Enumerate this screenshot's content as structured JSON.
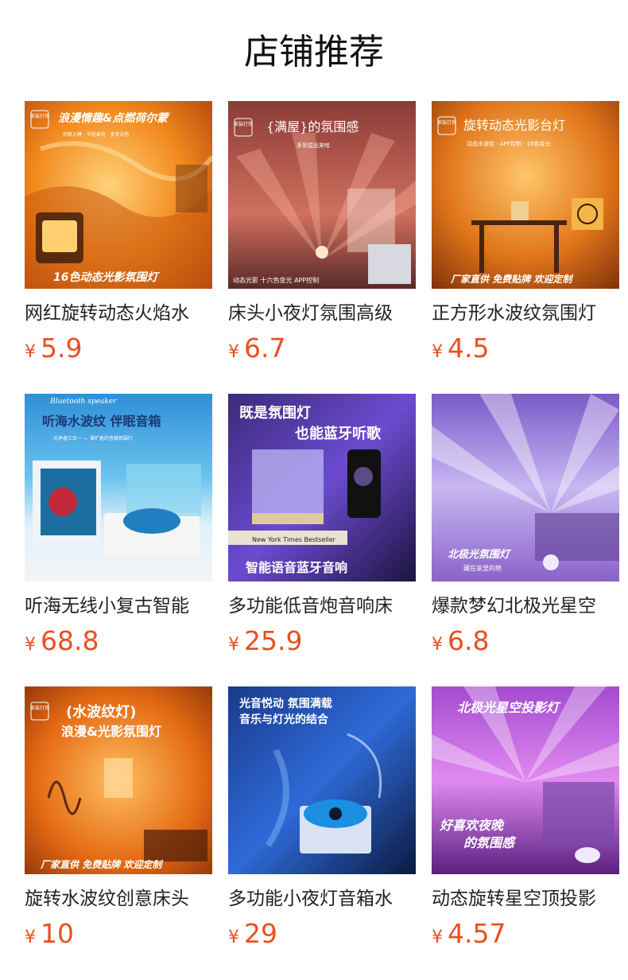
{
  "page": {
    "title": "店铺推荐"
  },
  "colors": {
    "price": "#e8501f",
    "title_text": "#222222",
    "background": "#ffffff"
  },
  "currency_symbol": "¥",
  "products": [
    {
      "title": "网红旋转动态火焰水",
      "price": "5.9",
      "image": {
        "headline": "浪漫情趣&点燃荷尔蒙",
        "sub": "伴眠入睡 · 节能省电 · 多变光色",
        "badge": "家装灯饰",
        "footer": "16色动态光影氛围灯"
      }
    },
    {
      "title": "床头小夜灯氛围高级",
      "price": "6.7",
      "image": {
        "headline": "{满屋}的氛围感",
        "sub": "多到溢出来哈",
        "badge": "家装灯饰",
        "footer": "动态光影 十六色变光 APP控制"
      }
    },
    {
      "title": "正方形水波纹氛围灯",
      "price": "4.5",
      "image": {
        "headline": "旋转动态光影台灯",
        "sub": "动态水波纹 · APP控制 · 16色变光",
        "badge": "家装灯饰",
        "footer": "厂家直供 免费贴牌 欢迎定制"
      }
    },
    {
      "title": "听海无线小复古智能",
      "price": "68.8",
      "image": {
        "headline": "听海水波纹 伴眠音箱",
        "sub": "光声香三合一 — 堪扩香的音箱氛围灯",
        "script": "Bluetooth speaker"
      }
    },
    {
      "title": "多功能低音炮音响床",
      "price": "25.9",
      "image": {
        "headline": "既是氛围灯",
        "headline2": "也能蓝牙听歌",
        "footer": "智能语音蓝牙音响",
        "book": "New York Times Bestseller"
      }
    },
    {
      "title": "爆款梦幻北极光星空",
      "price": "6.8",
      "image": {
        "headline": "北极光氛围灯",
        "sub": "藏在家里的绝"
      }
    },
    {
      "title": "旋转水波纹创意床头",
      "price": "10",
      "image": {
        "headline": "(水波纹灯)",
        "headline2": "浪漫&光影氛围灯",
        "badge": "家装灯饰",
        "footer": "厂家直供 免费贴牌 欢迎定制"
      }
    },
    {
      "title": "多功能小夜灯音箱水",
      "price": "29",
      "image": {
        "headline": "光音悦动 氛围满载",
        "headline2": "音乐与灯光的结合"
      }
    },
    {
      "title": "动态旋转星空顶投影",
      "price": "4.57",
      "image": {
        "headline": "北极光星空投影灯",
        "headline2": "好喜欢夜晚",
        "sub": "的氛围感"
      }
    }
  ]
}
